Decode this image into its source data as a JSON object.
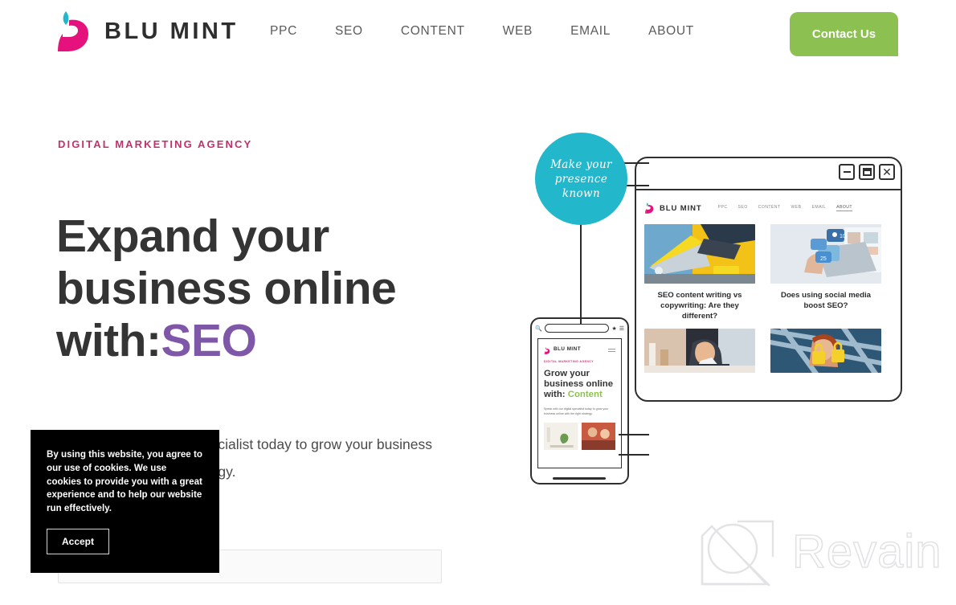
{
  "header": {
    "logo": {
      "text": "BLU MINT",
      "mark_icon": "blu-mint-logo-icon",
      "drop_color": "#22b7ca",
      "body_color": "#e5117c"
    },
    "nav": [
      {
        "label": "PPC"
      },
      {
        "label": "SEO"
      },
      {
        "label": "CONTENT"
      },
      {
        "label": "WEB"
      },
      {
        "label": "EMAIL"
      },
      {
        "label": "ABOUT"
      }
    ],
    "cta": {
      "label": "Contact Us",
      "color": "#8cc152"
    }
  },
  "hero": {
    "eyebrow": "DIGITAL MARKETING AGENCY",
    "eyebrow_color": "#c2316e",
    "headline_line1": "Expand your",
    "headline_line2": "business online",
    "headline_line3_prefix": "with:",
    "headline_accent": "SEO",
    "headline_accent_color": "#7e57a8",
    "subcopy": "Speak with our digital specialist today to grow your business online with the right strategy.",
    "input_value": "",
    "input_placeholder": ""
  },
  "cookie_banner": {
    "text": "By using this website, you agree to our use of cookies. We use cookies to provide you with a great experience and to help our website run effectively.",
    "accept_label": "Accept"
  },
  "illustration": {
    "bubble": {
      "line1": "Make your",
      "line2": "presence",
      "line3": "known",
      "color": "#22b7ca"
    },
    "browser_window": {
      "controls": [
        {
          "name": "minimize",
          "glyph": "—"
        },
        {
          "name": "maximize",
          "glyph": "▢"
        },
        {
          "name": "close",
          "glyph": "✕"
        }
      ],
      "site_logo_text": "BLU MINT",
      "nav": [
        {
          "label": "PPC"
        },
        {
          "label": "SEO"
        },
        {
          "label": "CONTENT"
        },
        {
          "label": "WEB"
        },
        {
          "label": "EMAIL"
        },
        {
          "label": "ABOUT"
        }
      ],
      "active_nav": "ABOUT",
      "cards": [
        {
          "title": "SEO content writing vs copywriting: Are they different?",
          "image": "laptop-typing-yellow-photo"
        },
        {
          "title": "Does using social media boost SEO?",
          "image": "social-media-icons-laptop-photo"
        }
      ],
      "cards_row2": [
        {
          "image": "woman-at-desk-photo"
        },
        {
          "image": "padlocks-security-photo"
        }
      ]
    },
    "tablet": {
      "site_logo_text": "BLU MINT",
      "eyebrow": "DIGITAL MARKETING AGENCY",
      "headline_line1": "Grow your",
      "headline_line2": "business online",
      "headline_line3_prefix": "with:",
      "headline_accent": "Content",
      "headline_accent_color": "#8cc152",
      "subcopy": "Speak with our digital specialist today to grow your business online with the right strategy."
    }
  },
  "watermark": {
    "text": "Revain",
    "logo_icon": "revain-logo-icon"
  }
}
